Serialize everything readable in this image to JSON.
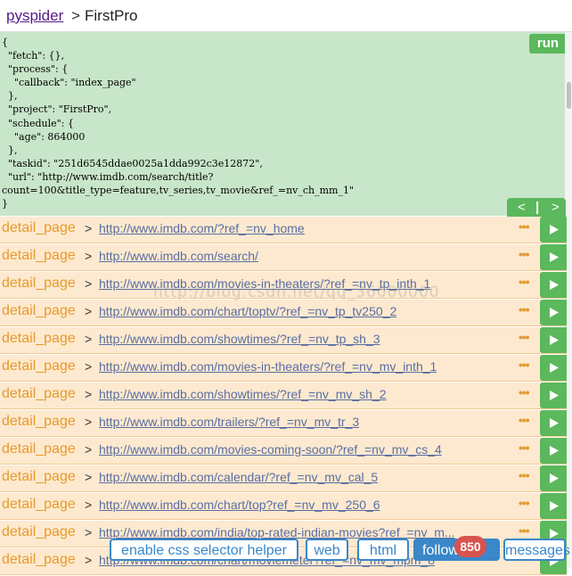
{
  "header": {
    "brand": "pyspider",
    "separator": ">",
    "project": "FirstPro"
  },
  "task_panel": {
    "json_text": "{\n  \"fetch\": {},\n  \"process\": {\n    \"callback\": \"index_page\"\n  },\n  \"project\": \"FirstPro\",\n  \"schedule\": {\n    \"age\": 864000\n  },\n  \"taskid\": \"251d6545ddae0025a1dda992c3e12872\",\n  \"url\": \"http://www.imdb.com/search/title?\ncount=100&title_type=feature,tv_series,tv_movie&ref_=nv_ch_mm_1\"\n}",
    "run_label": "run"
  },
  "nav": {
    "prev": "<",
    "bar": "|",
    "next": ">"
  },
  "follows": [
    {
      "callback": "detail_page",
      "url": "http://www.imdb.com/?ref_=nv_home"
    },
    {
      "callback": "detail_page",
      "url": "http://www.imdb.com/search/"
    },
    {
      "callback": "detail_page",
      "url": "http://www.imdb.com/movies-in-theaters/?ref_=nv_tp_inth_1"
    },
    {
      "callback": "detail_page",
      "url": "http://www.imdb.com/chart/toptv/?ref_=nv_tp_tv250_2"
    },
    {
      "callback": "detail_page",
      "url": "http://www.imdb.com/showtimes/?ref_=nv_tp_sh_3"
    },
    {
      "callback": "detail_page",
      "url": "http://www.imdb.com/movies-in-theaters/?ref_=nv_mv_inth_1"
    },
    {
      "callback": "detail_page",
      "url": "http://www.imdb.com/showtimes/?ref_=nv_mv_sh_2"
    },
    {
      "callback": "detail_page",
      "url": "http://www.imdb.com/trailers/?ref_=nv_mv_tr_3"
    },
    {
      "callback": "detail_page",
      "url": "http://www.imdb.com/movies-coming-soon/?ref_=nv_mv_cs_4"
    },
    {
      "callback": "detail_page",
      "url": "http://www.imdb.com/calendar/?ref_=nv_mv_cal_5"
    },
    {
      "callback": "detail_page",
      "url": "http://www.imdb.com/chart/top?ref_=nv_mv_250_6"
    },
    {
      "callback": "detail_page",
      "url": "http://www.imdb.com/india/top-rated-indian-movies?ref_=nv_m..."
    },
    {
      "callback": "detail_page",
      "url": "http://www.imdb.com/chart/moviemeter?ref_=nv_mv_mpm_8"
    }
  ],
  "row_greater": ">",
  "row_dots": "•••",
  "watermark": "http://blog.csdn.net/qq_36000000",
  "toolbar": {
    "css_helper": "enable css selector helper",
    "web": "web",
    "html": "html",
    "follows": "follows",
    "follows_count": "850",
    "messages": "messages"
  },
  "colors": {
    "task_bg": "#c8e6c9",
    "row_bg": "#fde9cf",
    "accent_green": "#5cb85c",
    "callback": "#e69a2e",
    "blue": "#3a87c9",
    "badge": "#d9534f"
  }
}
